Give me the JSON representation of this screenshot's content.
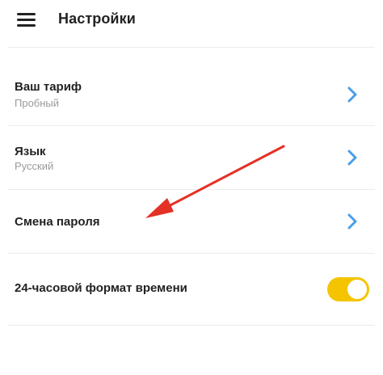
{
  "header": {
    "title": "Настройки",
    "menu_icon": "hamburger-menu-icon"
  },
  "settings": {
    "tariff": {
      "label": "Ваш тариф",
      "value": "Пробный"
    },
    "language": {
      "label": "Язык",
      "value": "Русский"
    },
    "password": {
      "label": "Смена пароля"
    },
    "time_format": {
      "label": "24-часовой формат времени",
      "enabled": true
    }
  },
  "colors": {
    "chevron": "#4a9ee8",
    "toggle_on": "#f5c400",
    "annotation_arrow": "#e53025",
    "divider": "#ececec"
  }
}
